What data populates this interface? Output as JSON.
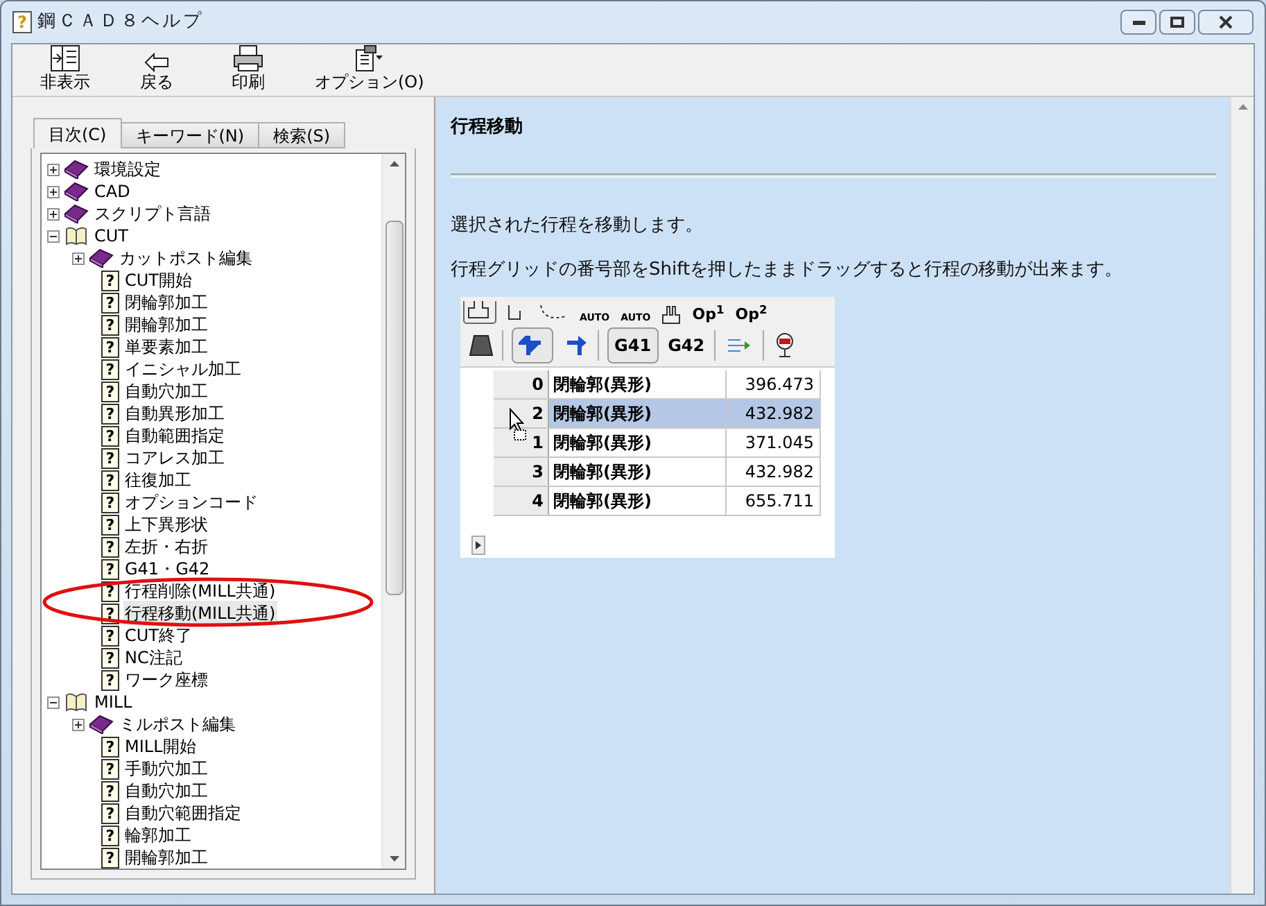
{
  "window": {
    "title": "鋼ＣＡＤ８ヘルプ",
    "icon": "?"
  },
  "toolbar": [
    {
      "label": "非表示",
      "kind": "hide"
    },
    {
      "label": "戻る",
      "kind": "back"
    },
    {
      "label": "印刷",
      "kind": "print"
    },
    {
      "label": "オプション(O)",
      "kind": "options"
    }
  ],
  "tabs": [
    {
      "label": "目次(C)",
      "selected": true
    },
    {
      "label": "キーワード(N)",
      "selected": false
    },
    {
      "label": "検索(S)",
      "selected": false
    }
  ],
  "tree": [
    {
      "label": "環境設定",
      "kind": "book",
      "expanded": false
    },
    {
      "label": "CAD",
      "kind": "book",
      "expanded": false
    },
    {
      "label": "スクリプト言語",
      "kind": "book",
      "expanded": false
    },
    {
      "label": "CUT",
      "kind": "book",
      "expanded": true,
      "children": [
        {
          "label": "カットポスト編集",
          "kind": "book",
          "expanded": false
        },
        {
          "label": "CUT開始",
          "kind": "page",
          "icon": "?",
          "selected": false
        },
        {
          "label": "閉輪郭加工",
          "kind": "page",
          "icon": "?",
          "selected": false
        },
        {
          "label": "開輪郭加工",
          "kind": "page",
          "icon": "?",
          "selected": false
        },
        {
          "label": "単要素加工",
          "kind": "page",
          "icon": "?",
          "selected": false
        },
        {
          "label": "イニシャル加工",
          "kind": "page",
          "icon": "?",
          "selected": false
        },
        {
          "label": "自動穴加工",
          "kind": "page",
          "icon": "?",
          "selected": false
        },
        {
          "label": "自動異形加工",
          "kind": "page",
          "icon": "?",
          "selected": false
        },
        {
          "label": "自動範囲指定",
          "kind": "page",
          "icon": "?",
          "selected": false
        },
        {
          "label": "コアレス加工",
          "kind": "page",
          "icon": "?",
          "selected": false
        },
        {
          "label": "往復加工",
          "kind": "page",
          "icon": "?",
          "selected": false
        },
        {
          "label": "オプションコード",
          "kind": "page",
          "icon": "?",
          "selected": false
        },
        {
          "label": "上下異形状",
          "kind": "page",
          "icon": "?",
          "selected": false
        },
        {
          "label": "左折・右折",
          "kind": "page",
          "icon": "?",
          "selected": false
        },
        {
          "label": "G41・G42",
          "kind": "page",
          "icon": "?",
          "selected": false
        },
        {
          "label": "行程削除(MILL共通)",
          "kind": "page",
          "icon": "?",
          "selected": false
        },
        {
          "label": "行程移動(MILL共通)",
          "kind": "page",
          "icon": "?",
          "selected": true
        },
        {
          "label": "CUT終了",
          "kind": "page",
          "icon": "?",
          "selected": false
        },
        {
          "label": "NC注記",
          "kind": "page",
          "icon": "?",
          "selected": false
        },
        {
          "label": "ワーク座標",
          "kind": "page",
          "icon": "?",
          "selected": false
        }
      ]
    },
    {
      "label": "MILL",
      "kind": "book",
      "expanded": true,
      "children": [
        {
          "label": "ミルポスト編集",
          "kind": "book",
          "expanded": false
        },
        {
          "label": "MILL開始",
          "kind": "page",
          "icon": "?",
          "selected": false
        },
        {
          "label": "手動穴加工",
          "kind": "page",
          "icon": "?",
          "selected": false
        },
        {
          "label": "自動穴加工",
          "kind": "page",
          "icon": "?",
          "selected": false
        },
        {
          "label": "自動穴範囲指定",
          "kind": "page",
          "icon": "?",
          "selected": false
        },
        {
          "label": "輪郭加工",
          "kind": "page",
          "icon": "?",
          "selected": false
        },
        {
          "label": "開輪郭加工",
          "kind": "page",
          "icon": "?",
          "selected": false
        }
      ]
    }
  ],
  "content": {
    "heading": "行程移動",
    "paragraphs": [
      "選択された行程を移動します。",
      "行程グリッドの番号部をShiftを押したままドラッグすると行程の移動が出来ます。"
    ],
    "screenshot": {
      "toolbar_row_1": [
        "AUTO",
        "AUTO",
        "Op$^{1}$",
        "Op$^{2}$"
      ],
      "toolbar_row_2": [
        {
          "label": "G41",
          "selected": true
        },
        {
          "label": "G42",
          "selected": false
        }
      ],
      "rows": [
        {
          "number": "0",
          "name": "閉輪郭(異形)",
          "value": "396.473",
          "selected": false
        },
        {
          "number": "2",
          "name": "閉輪郭(異形)",
          "value": "432.982",
          "selected": true
        },
        {
          "number": "1",
          "name": "閉輪郭(異形)",
          "value": "371.045",
          "selected": false
        },
        {
          "number": "3",
          "name": "閉輪郭(異形)",
          "value": "432.982",
          "selected": false
        },
        {
          "number": "4",
          "name": "閉輪郭(異形)",
          "value": "655.711",
          "selected": false
        }
      ]
    }
  }
}
